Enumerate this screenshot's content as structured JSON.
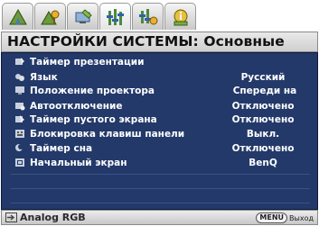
{
  "tabs": [
    {
      "icon": "picture-icon"
    },
    {
      "icon": "advanced-picture-icon"
    },
    {
      "icon": "display-icon"
    },
    {
      "icon": "system-setup-basic-icon",
      "active": true
    },
    {
      "icon": "system-setup-advanced-icon"
    },
    {
      "icon": "information-icon"
    }
  ],
  "title": "НАСТРОЙКИ СИСТЕМЫ: Основные",
  "items": [
    {
      "label": "Таймер презентации",
      "value": ""
    },
    {
      "label": "Язык",
      "value": "Русский"
    },
    {
      "label": "Положение проектора",
      "value": "Спереди на"
    },
    {
      "label": "Автоотключение",
      "value": "Отключено"
    },
    {
      "label": "Таймер пустого экрана",
      "value": "Отключено"
    },
    {
      "label": "Блокировка клавиш панели",
      "value": "Выкл."
    },
    {
      "label": "Таймер сна",
      "value": "Отключено"
    },
    {
      "label": "Начальный экран",
      "value": "BenQ"
    }
  ],
  "status": {
    "source": "Analog RGB",
    "menu_key": "MENU",
    "exit_label": "Выход"
  },
  "colors": {
    "menu_bg": "#23396a",
    "title_bg": "#dcdcdc"
  }
}
